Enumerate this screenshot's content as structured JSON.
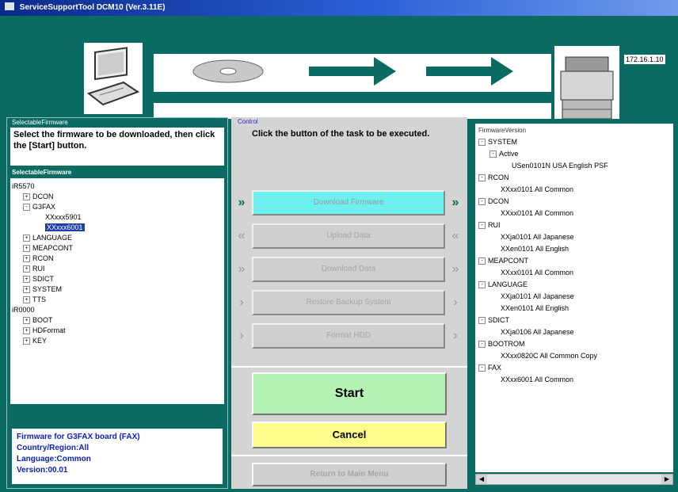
{
  "window": {
    "title": "ServiceSupportTool DCM10 (Ver.3.11E)"
  },
  "banner": {
    "ip": "172.16.1.10"
  },
  "left": {
    "group_label": "SelectableFirmware",
    "instruction": "Select the firmware to be downloaded, then click the [Start] button.",
    "sub_header": "SelectableFirmware",
    "tree": [
      {
        "label": "iR5570",
        "indent": 0,
        "exp": ""
      },
      {
        "label": "DCON",
        "indent": 1,
        "exp": "+"
      },
      {
        "label": "G3FAX",
        "indent": 1,
        "exp": "-"
      },
      {
        "label": "XXxxx5901",
        "indent": 3,
        "exp": ""
      },
      {
        "label": "XXxxx6001",
        "indent": 3,
        "exp": "",
        "selected": true
      },
      {
        "label": "LANGUAGE",
        "indent": 1,
        "exp": "+"
      },
      {
        "label": "MEAPCONT",
        "indent": 1,
        "exp": "+"
      },
      {
        "label": "RCON",
        "indent": 1,
        "exp": "+"
      },
      {
        "label": "RUI",
        "indent": 1,
        "exp": "+"
      },
      {
        "label": "SDICT",
        "indent": 1,
        "exp": "+"
      },
      {
        "label": "SYSTEM",
        "indent": 1,
        "exp": "+"
      },
      {
        "label": "TTS",
        "indent": 1,
        "exp": "+"
      },
      {
        "label": "iR0000",
        "indent": 0,
        "exp": ""
      },
      {
        "label": "BOOT",
        "indent": 1,
        "exp": "+"
      },
      {
        "label": "HDFormat",
        "indent": 1,
        "exp": "+"
      },
      {
        "label": "KEY",
        "indent": 1,
        "exp": "+"
      }
    ],
    "info": [
      "Firmware for G3FAX board (FAX)",
      "Country/Region:All",
      "Language:Common",
      "Version:00.01"
    ]
  },
  "middle": {
    "group_label": "Control",
    "instruction": "Click the button of the task to be executed.",
    "tasks": [
      {
        "label": "Download Firmware",
        "chevron": "»",
        "active": true
      },
      {
        "label": "Upload Data",
        "chevron": "«",
        "active": false
      },
      {
        "label": "Download Data",
        "chevron": "»",
        "active": false
      },
      {
        "label": "Restore Backup System",
        "chevron": "›",
        "active": false
      },
      {
        "label": "Format HDD",
        "chevron": "›",
        "active": false
      }
    ],
    "start_label": "Start",
    "cancel_label": "Cancel",
    "return_label": "Return to Main Menu"
  },
  "right": {
    "caption": "FirmwareVersion",
    "tree": [
      {
        "label": "SYSTEM",
        "indent": 0,
        "exp": "-"
      },
      {
        "label": "Active",
        "indent": 1,
        "exp": "-"
      },
      {
        "label": "USen0101N USA English PSF",
        "indent": 3,
        "exp": ""
      },
      {
        "label": "RCON",
        "indent": 0,
        "exp": "-"
      },
      {
        "label": "XXxx0101 All Common",
        "indent": 2,
        "exp": ""
      },
      {
        "label": "DCON",
        "indent": 0,
        "exp": "-"
      },
      {
        "label": "XXxx0101 All Common",
        "indent": 2,
        "exp": ""
      },
      {
        "label": "RUI",
        "indent": 0,
        "exp": "-"
      },
      {
        "label": "XXja0101 All Japanese",
        "indent": 2,
        "exp": ""
      },
      {
        "label": "XXen0101 All English",
        "indent": 2,
        "exp": ""
      },
      {
        "label": "MEAPCONT",
        "indent": 0,
        "exp": "-"
      },
      {
        "label": "XXxx0101 All Common",
        "indent": 2,
        "exp": ""
      },
      {
        "label": "LANGUAGE",
        "indent": 0,
        "exp": "-"
      },
      {
        "label": "XXja0101 All Japanese",
        "indent": 2,
        "exp": ""
      },
      {
        "label": "XXen0101 All English",
        "indent": 2,
        "exp": ""
      },
      {
        "label": "SDICT",
        "indent": 0,
        "exp": "-"
      },
      {
        "label": "XXja0106 All Japanese",
        "indent": 2,
        "exp": ""
      },
      {
        "label": "BOOTROM",
        "indent": 0,
        "exp": "-"
      },
      {
        "label": "XXxx0820C All Common Copy",
        "indent": 2,
        "exp": ""
      },
      {
        "label": "FAX",
        "indent": 0,
        "exp": "-"
      },
      {
        "label": "XXxx6001 All Common",
        "indent": 2,
        "exp": ""
      }
    ]
  },
  "colors": {
    "teal": "#0a6b62",
    "active_task": "#6ff0f0",
    "start": "#b3f2b3",
    "cancel": "#fdfd8c",
    "selected": "#1e3ea6"
  }
}
